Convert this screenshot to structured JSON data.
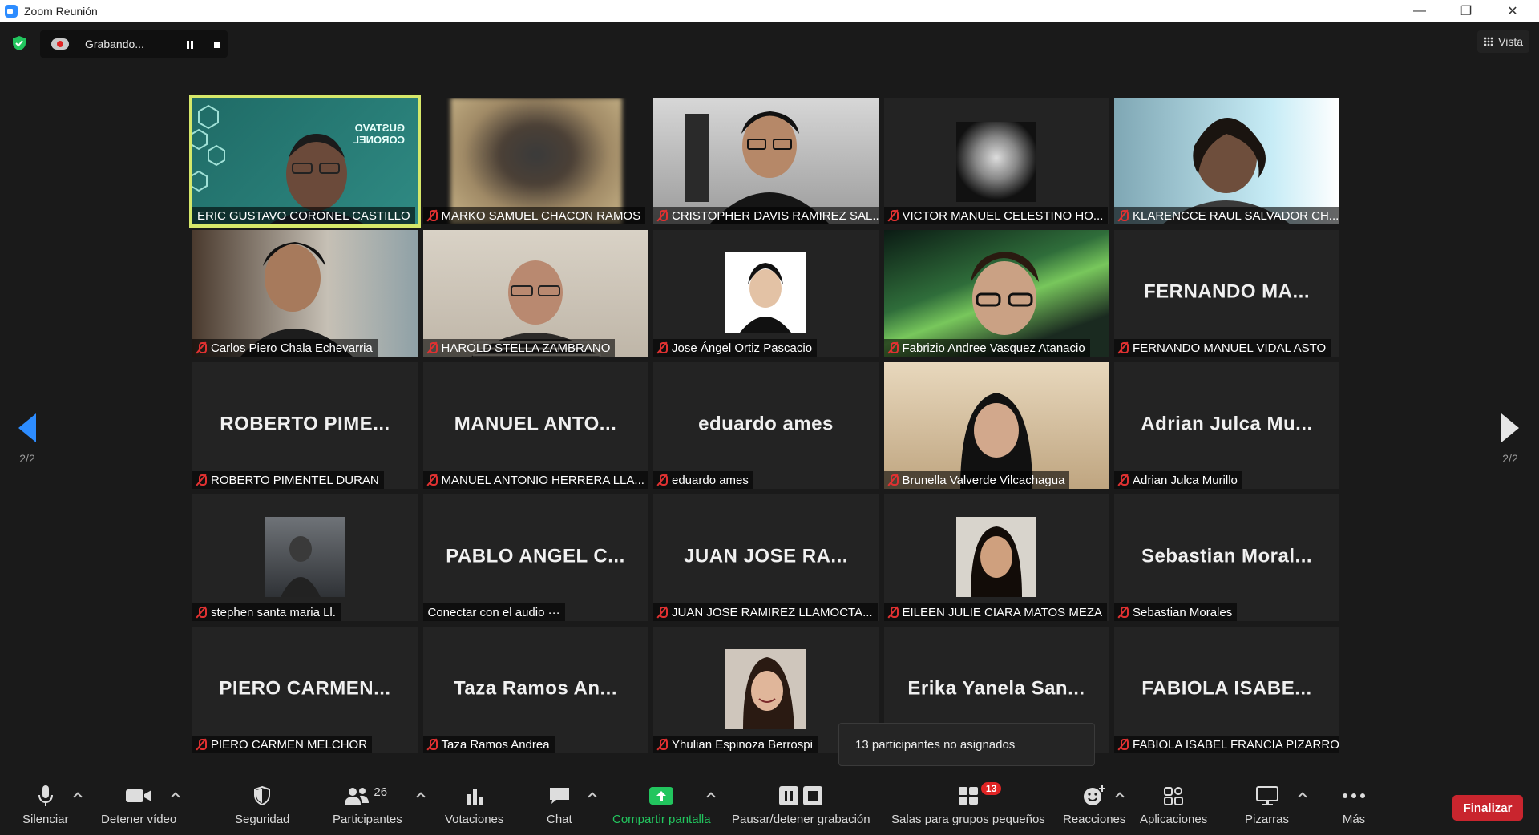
{
  "window": {
    "title": "Zoom Reunión"
  },
  "recording": {
    "label": "Grabando..."
  },
  "view": {
    "label": "Vista"
  },
  "paging": {
    "left": "2/2",
    "right": "2/2"
  },
  "tiles": [
    {
      "name": "ERIC GUSTAVO CORONEL CASTILLO",
      "big": "",
      "kind": "video-teacher",
      "muted": false,
      "active": true
    },
    {
      "name": "MARKO SAMUEL CHACON RAMOS",
      "big": "",
      "kind": "video-blur",
      "muted": true
    },
    {
      "name": "CRISTOPHER DAVIS RAMIREZ SAL...",
      "big": "",
      "kind": "video-room",
      "muted": true
    },
    {
      "name": "VICTOR MANUEL CELESTINO HO...",
      "big": "",
      "kind": "photo-bw",
      "muted": true
    },
    {
      "name": "KLARENCCE RAUL SALVADOR CH...",
      "big": "",
      "kind": "video-light",
      "muted": true
    },
    {
      "name": "Carlos Piero Chala Echevarria",
      "big": "",
      "kind": "video-room2",
      "muted": true
    },
    {
      "name": "HAROLD STELLA ZAMBRANO",
      "big": "",
      "kind": "video-room3",
      "muted": true
    },
    {
      "name": "Jose Ángel Ortiz Pascacio",
      "big": "",
      "kind": "photo-id",
      "muted": true
    },
    {
      "name": "Fabrizio Andree Vasquez Atanacio",
      "big": "",
      "kind": "video-aurora",
      "muted": true
    },
    {
      "name": "FERNANDO MANUEL VIDAL ASTO",
      "big": "FERNANDO  MA...",
      "kind": "name",
      "muted": true
    },
    {
      "name": "ROBERTO PIMENTEL DURAN",
      "big": "ROBERTO  PIME...",
      "kind": "name",
      "muted": true
    },
    {
      "name": "MANUEL ANTONIO HERRERA LLA...",
      "big": "MANUEL  ANTO...",
      "kind": "name",
      "muted": true
    },
    {
      "name": "eduardo ames",
      "big": "eduardo ames",
      "kind": "name",
      "muted": true
    },
    {
      "name": "Brunella Valverde Vilcachagua",
      "big": "",
      "kind": "video-girl",
      "muted": true
    },
    {
      "name": "Adrian Julca Murillo",
      "big": "Adrian  Julca  Mu...",
      "kind": "name",
      "muted": true
    },
    {
      "name": "stephen santa maria Ll.",
      "big": "",
      "kind": "photo-dark",
      "muted": true
    },
    {
      "name": "Conectar con el audio  ···",
      "big": "PABLO  ANGEL  C...",
      "kind": "name",
      "muted": false
    },
    {
      "name": "JUAN JOSE RAMIREZ LLAMOCTA...",
      "big": "JUAN  JOSE  RA...",
      "kind": "name",
      "muted": true
    },
    {
      "name": "EILEEN JULIE CIARA MATOS MEZA",
      "big": "",
      "kind": "photo-girl",
      "muted": true
    },
    {
      "name": "Sebastian Morales",
      "big": "Sebastian  Moral...",
      "kind": "name",
      "muted": true
    },
    {
      "name": "PIERO CARMEN MELCHOR",
      "big": "PIERO  CARMEN...",
      "kind": "name",
      "muted": true
    },
    {
      "name": "Taza Ramos Andrea",
      "big": "Taza  Ramos  An...",
      "kind": "name",
      "muted": true
    },
    {
      "name": "Yhulian Espinoza Berrospi",
      "big": "",
      "kind": "photo-smile",
      "muted": true
    },
    {
      "name": "",
      "big": "Erika  Yanela  San...",
      "kind": "name",
      "muted": false
    },
    {
      "name": "FABIOLA ISABEL FRANCIA PIZARRO",
      "big": "FABIOLA  ISABE...",
      "kind": "name",
      "muted": true
    }
  ],
  "teacher_banner": {
    "line1": "GUSTAVO",
    "line2": "CORONEL"
  },
  "tooltip": {
    "text": "13 participantes no asignados"
  },
  "toolbar": {
    "mute": "Silenciar",
    "video": "Detener vídeo",
    "security": "Seguridad",
    "participants": "Participantes",
    "participants_count": "26",
    "polls": "Votaciones",
    "chat": "Chat",
    "share": "Compartir pantalla",
    "record": "Pausar/detener grabación",
    "breakout": "Salas para grupos pequeños",
    "breakout_badge": "13",
    "reactions": "Reacciones",
    "apps": "Aplicaciones",
    "whiteboards": "Pizarras",
    "more": "Más",
    "end": "Finalizar"
  },
  "colors": {
    "active_speaker": "#d6e86a",
    "share_green": "#22c55e",
    "end_red": "#c9252e",
    "accent_blue": "#2d8cff"
  }
}
